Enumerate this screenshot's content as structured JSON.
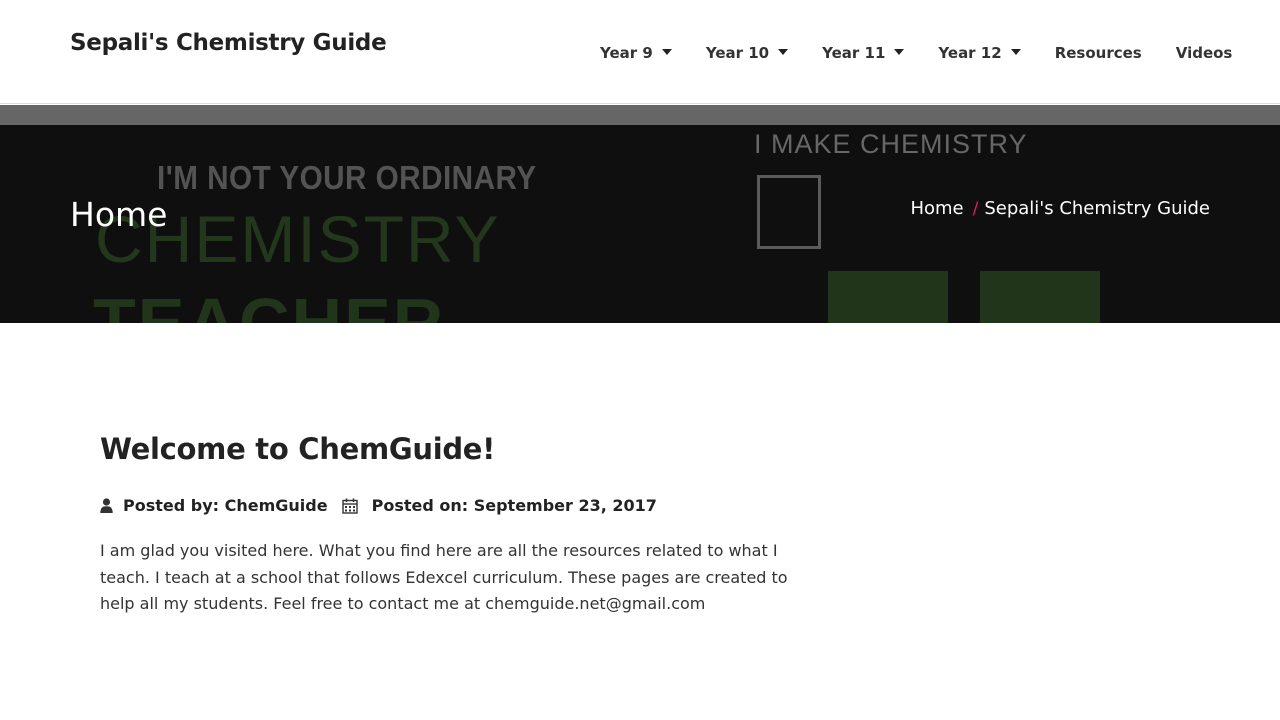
{
  "header": {
    "site_title": "Sepali's Chemistry Guide",
    "nav": [
      {
        "label": "Year 9",
        "dropdown": true
      },
      {
        "label": "Year 10",
        "dropdown": true
      },
      {
        "label": "Year 11",
        "dropdown": true
      },
      {
        "label": "Year 12",
        "dropdown": true
      },
      {
        "label": "Resources",
        "dropdown": false
      },
      {
        "label": "Videos",
        "dropdown": false
      }
    ]
  },
  "banner": {
    "title": "Home",
    "breadcrumb": {
      "home": "Home",
      "separator": "/",
      "current": "Sepali's Chemistry Guide"
    },
    "image_text": {
      "line1": "I'M NOT YOUR ORDINARY",
      "line2": "CHEMISTRY",
      "line3": "TEACHER",
      "right": "I MAKE CHEMISTRY"
    }
  },
  "post": {
    "title": "Welcome to ChemGuide!",
    "posted_by": "Posted by: ChemGuide",
    "posted_on": "Posted on: September 23, 2017",
    "body": "I am glad you visited here. What you find here are all the resources related to what I teach. I teach at a school that follows Edexcel curriculum. These pages are created to help all my students. Feel free to contact me at chemguide.net@gmail.com"
  },
  "colors": {
    "breadcrumb_separator": "#e8175d",
    "banner_bg": "#141414",
    "strip": "#666666"
  },
  "icons": {
    "posted_by": "user-icon",
    "posted_on": "calendar-icon",
    "dropdown": "caret-down-icon"
  }
}
